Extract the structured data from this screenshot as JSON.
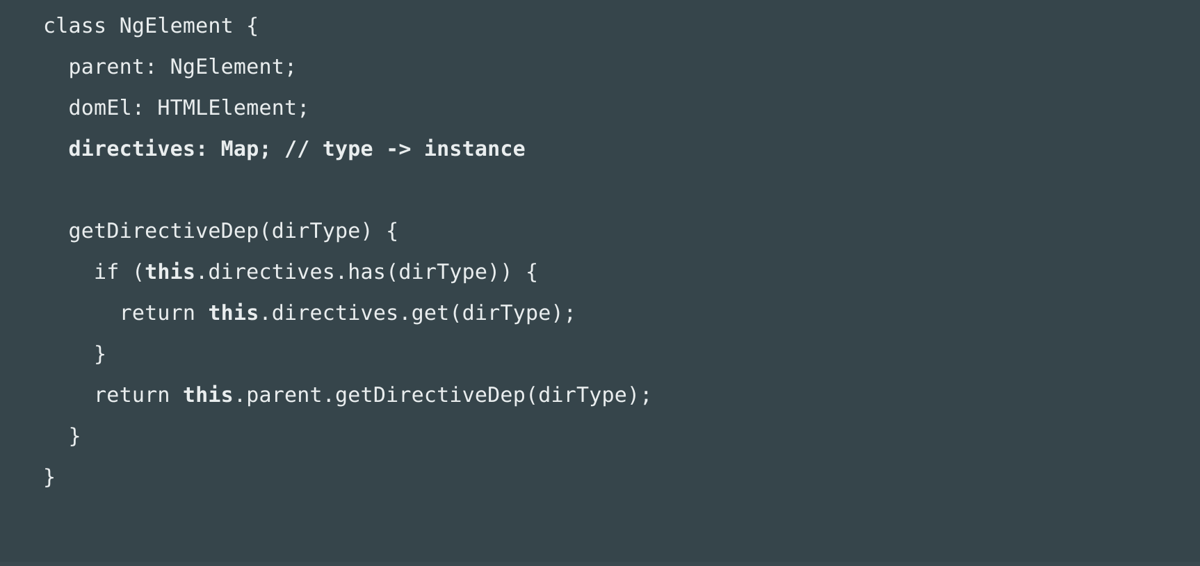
{
  "editor": {
    "background_color": "#36454b",
    "text_color": "#e9edee",
    "language": "typescript",
    "font_size_px": 30
  },
  "code": {
    "lines": [
      {
        "indent": "",
        "segments": [
          {
            "text": "class NgElement {",
            "bold": false
          }
        ]
      },
      {
        "indent": "  ",
        "segments": [
          {
            "text": "parent: NgElement;",
            "bold": false
          }
        ]
      },
      {
        "indent": "  ",
        "segments": [
          {
            "text": "domEl: HTMLElement;",
            "bold": false
          }
        ]
      },
      {
        "indent": "  ",
        "segments": [
          {
            "text": "directives: Map; // type -> instance",
            "bold": true
          }
        ]
      },
      {
        "indent": "",
        "segments": []
      },
      {
        "indent": "  ",
        "segments": [
          {
            "text": "getDirectiveDep(dirType) {",
            "bold": false
          }
        ]
      },
      {
        "indent": "    ",
        "segments": [
          {
            "text": "if (",
            "bold": false
          },
          {
            "text": "this",
            "bold": true
          },
          {
            "text": ".directives.has(dirType)) {",
            "bold": false
          }
        ]
      },
      {
        "indent": "      ",
        "segments": [
          {
            "text": "return ",
            "bold": false
          },
          {
            "text": "this",
            "bold": true
          },
          {
            "text": ".directives.get(dirType);",
            "bold": false
          }
        ]
      },
      {
        "indent": "    ",
        "segments": [
          {
            "text": "}",
            "bold": false
          }
        ]
      },
      {
        "indent": "    ",
        "segments": [
          {
            "text": "return ",
            "bold": false
          },
          {
            "text": "this",
            "bold": true
          },
          {
            "text": ".parent.getDirectiveDep(dirType);",
            "bold": false
          }
        ]
      },
      {
        "indent": "  ",
        "segments": [
          {
            "text": "}",
            "bold": false
          }
        ]
      },
      {
        "indent": "",
        "segments": [
          {
            "text": "}",
            "bold": false
          }
        ]
      }
    ]
  }
}
